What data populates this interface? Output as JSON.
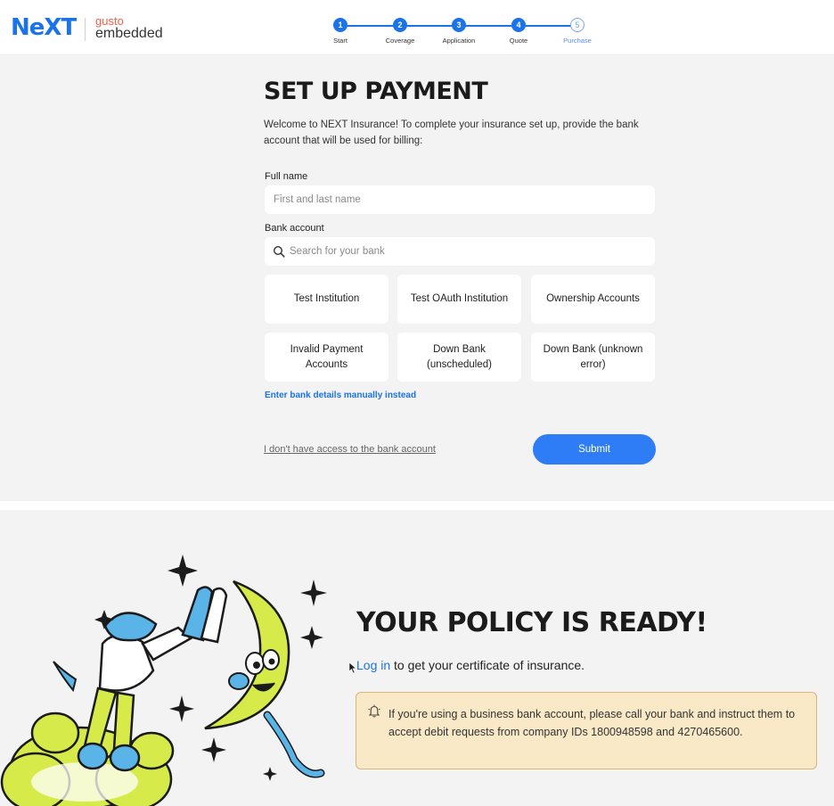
{
  "header": {
    "brand": "NeXT",
    "partner_top": "gusto",
    "partner_bottom": "embedded",
    "steps": [
      {
        "number": "1",
        "label": "Start",
        "state": "complete"
      },
      {
        "number": "2",
        "label": "Coverage",
        "state": "complete"
      },
      {
        "number": "3",
        "label": "Application",
        "state": "complete"
      },
      {
        "number": "4",
        "label": "Quote",
        "state": "complete"
      },
      {
        "number": "5",
        "label": "Purchase",
        "state": "current"
      }
    ]
  },
  "payment": {
    "title": "SET UP PAYMENT",
    "description": "Welcome to NEXT Insurance! To complete your insurance set up, provide the bank account that will be used for billing:",
    "full_name_label": "Full name",
    "full_name_placeholder": "First and last name",
    "bank_label": "Bank account",
    "bank_search_placeholder": "Search for your bank",
    "banks": [
      "Test Institution",
      "Test OAuth Institution",
      "Ownership Accounts",
      "Invalid Payment Accounts",
      "Down Bank (unscheduled)",
      "Down Bank (unknown error)"
    ],
    "manual_link": "Enter bank details manually instead",
    "no_access_link": "I don't have access to the bank account",
    "submit_label": "Submit"
  },
  "policy": {
    "title": "YOUR POLICY IS READY!",
    "login_link": "Log in",
    "login_suffix": " to get your certificate of insurance.",
    "notice": "If you're using a business bank account, please call your bank and instruct them to accept debit requests from company IDs 1800948598 and 4270465600."
  },
  "colors": {
    "accent": "#1a73e8",
    "submit": "#2f7df6",
    "panel_bg": "#f3f3f3",
    "notice_bg": "#f9e9c7",
    "illustration_green": "#d6ea4a",
    "illustration_blue": "#5ab4e8"
  },
  "icons": {
    "search": "search-icon",
    "notice": "bell-icon"
  }
}
